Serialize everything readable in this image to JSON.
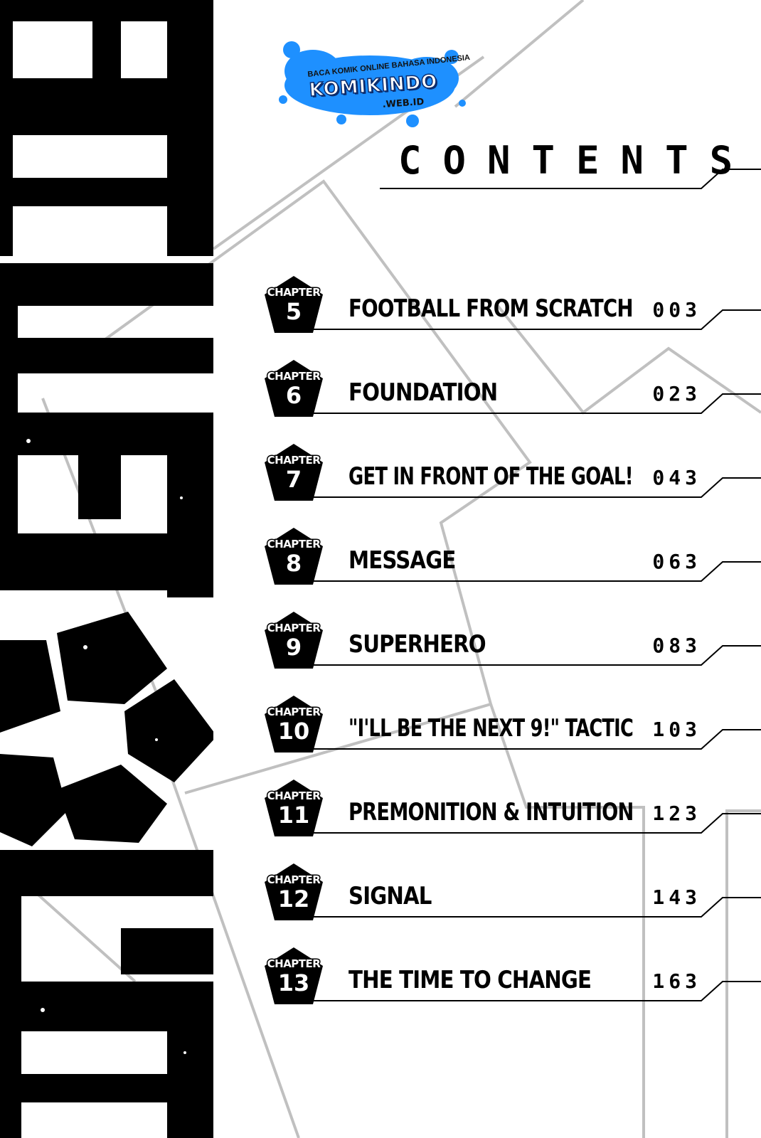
{
  "watermark": {
    "tagline": "BACA KOMIK ONLINE BAHASA INDONESIA",
    "brand": "KOMIKINDO",
    "domain": ".WEB.ID",
    "color_primary": "#1e90ff",
    "color_dark": "#0b2c6e"
  },
  "heading": "CONTENTS",
  "chapters": [
    {
      "label": "CHAPTER",
      "number": "5",
      "title": "FOOTBALL FROM SCRATCH",
      "page": "003"
    },
    {
      "label": "CHAPTER",
      "number": "6",
      "title": "FOUNDATION",
      "page": "023"
    },
    {
      "label": "CHAPTER",
      "number": "7",
      "title": "GET IN FRONT OF THE GOAL!",
      "page": "043"
    },
    {
      "label": "CHAPTER",
      "number": "8",
      "title": "MESSAGE",
      "page": "063"
    },
    {
      "label": "CHAPTER",
      "number": "9",
      "title": "SUPERHERO",
      "page": "083"
    },
    {
      "label": "CHAPTER",
      "number": "10",
      "title": "\"I'LL BE THE NEXT 9!\" TACTIC",
      "page": "103"
    },
    {
      "label": "CHAPTER",
      "number": "11",
      "title": "PREMONITION & INTUITION",
      "page": "123"
    },
    {
      "label": "CHAPTER",
      "number": "12",
      "title": "SIGNAL",
      "page": "143"
    },
    {
      "label": "CHAPTER",
      "number": "13",
      "title": "THE TIME TO CHANGE",
      "page": "163"
    }
  ],
  "colors": {
    "ink": "#000000",
    "guide_lines": "#c0c0c0",
    "paper": "#ffffff"
  }
}
